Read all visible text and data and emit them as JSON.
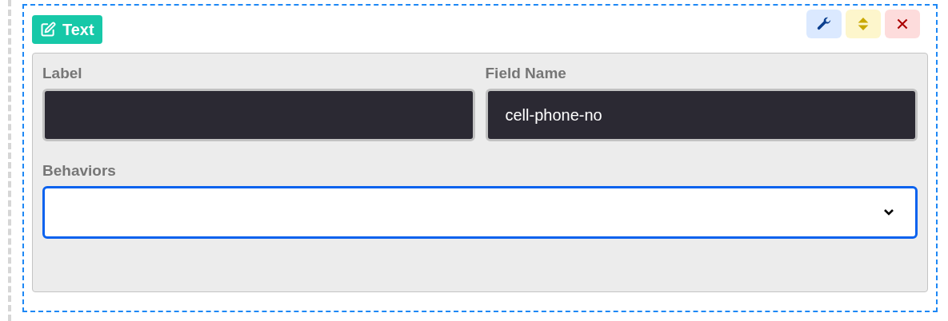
{
  "badge": {
    "label": "Text"
  },
  "fields": [
    {
      "label": "Label"
    },
    {
      "label": "Field Name",
      "value": "cell-phone-no"
    }
  ],
  "behaviors": {
    "label": "Behaviors",
    "focused": true
  }
}
